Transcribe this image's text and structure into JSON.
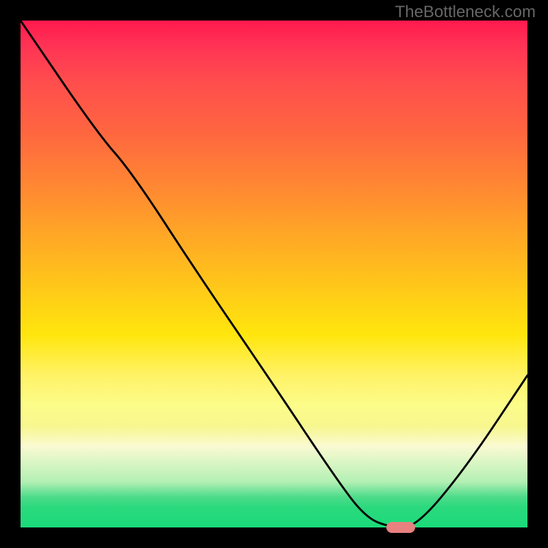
{
  "watermark": "TheBottleneck.com",
  "chart_data": {
    "type": "line",
    "title": "",
    "xlabel": "",
    "ylabel": "",
    "xlim": [
      0,
      100
    ],
    "ylim": [
      0,
      100
    ],
    "series": [
      {
        "name": "curve",
        "x": [
          0,
          15,
          22,
          35,
          50,
          62,
          68,
          73,
          78,
          88,
          100
        ],
        "values": [
          100,
          78,
          70,
          50,
          28,
          10,
          2,
          0,
          0,
          12,
          30
        ]
      }
    ],
    "marker": {
      "x": 75,
      "y": 0
    },
    "gradient_stops": [
      {
        "pos": 0,
        "color": "#ff1a4d"
      },
      {
        "pos": 50,
        "color": "#ffc61a"
      },
      {
        "pos": 80,
        "color": "#fafad2"
      },
      {
        "pos": 100,
        "color": "#1adb7a"
      }
    ]
  }
}
